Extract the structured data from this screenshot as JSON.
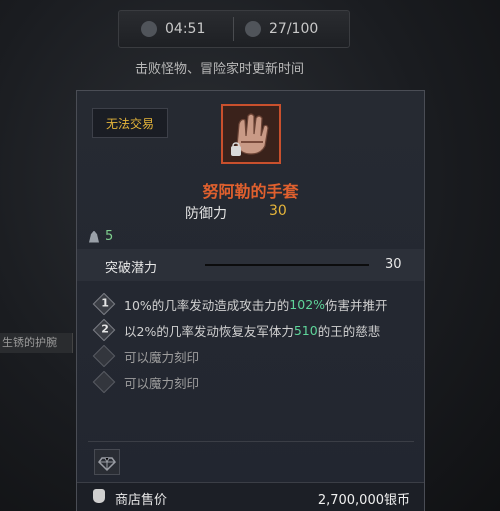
{
  "topbar": {
    "time": "04:51",
    "count": "27/100",
    "subtitle": "击败怪物、冒险家时更新时间"
  },
  "side_label": "生锈的护腕",
  "item": {
    "trade_status": "无法交易",
    "name": "努阿勒的手套",
    "stat_label": "防御力",
    "stat_value": "30",
    "level": "5",
    "break_label": "突破潜力",
    "break_value": "30",
    "options": [
      {
        "num": "1",
        "pre": "10%的几率发动造成攻击力的",
        "hl": "102%",
        "post": "伤害并推开"
      },
      {
        "num": "2",
        "pre": "以2%的几率发动恢复友军体力",
        "hl": "510",
        "post": "的王的慈悲"
      },
      {
        "text": "可以魔力刻印"
      },
      {
        "text": "可以魔力刻印"
      }
    ],
    "price_label": "商店售价",
    "price_value": "2,700,000银币"
  },
  "colors": {
    "accent_orange": "#e0602e",
    "gold": "#e6b53a",
    "green": "#5fd59a"
  },
  "icons": [
    "clock-icon",
    "person-icon",
    "gauntlet-icon",
    "weight-icon",
    "gem-icon",
    "money-bag-icon"
  ]
}
